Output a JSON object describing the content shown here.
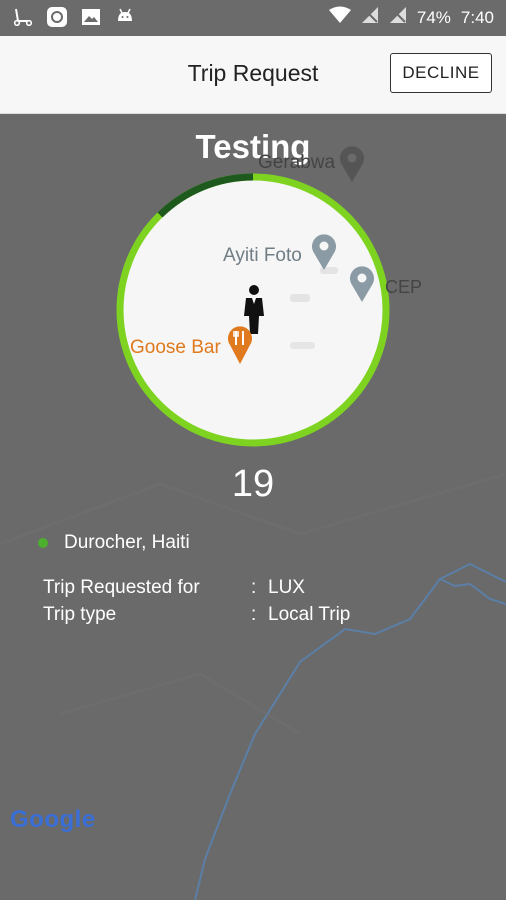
{
  "status_bar": {
    "left_icons": [
      "scooter-icon",
      "app-icon",
      "image-icon",
      "android-icon"
    ],
    "battery": "74%",
    "time": "7:40"
  },
  "app_bar": {
    "title": "Trip Request",
    "decline_label": "DECLINE"
  },
  "map": {
    "labels": {
      "place1": "Gerabwa",
      "place2": "Ayiti Foto",
      "place3": "CEP",
      "place4": "Goose Bar"
    },
    "attribution": "Google"
  },
  "request": {
    "passenger_name": "Testing",
    "countdown": "19",
    "location": "Durocher, Haiti",
    "details": [
      {
        "key": "Trip Requested for",
        "sep": ":",
        "value": "LUX"
      },
      {
        "key": "Trip type",
        "sep": ":",
        "value": "Local Trip"
      }
    ]
  },
  "colors": {
    "ring": "#7ed321",
    "ring_progress": "#1e5a1e",
    "location_dot": "#4caf2d",
    "restaurant": "#e07a1e"
  }
}
